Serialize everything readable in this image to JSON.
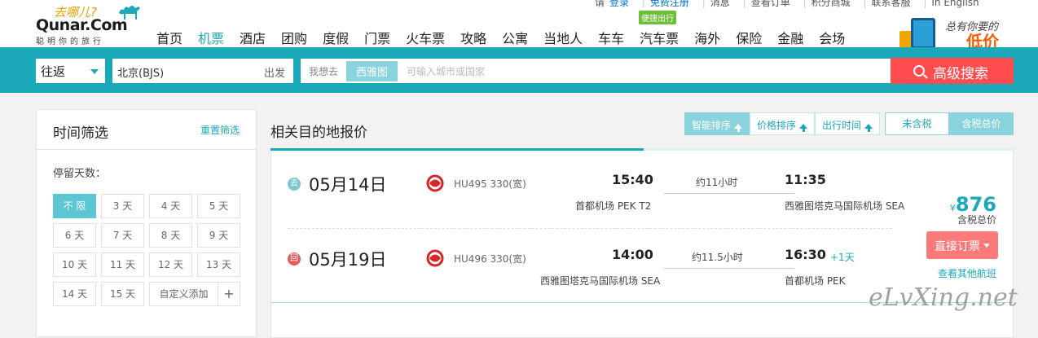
{
  "toplinks": {
    "please": "请",
    "login": "登录",
    "register": "免费注册",
    "messages": "消息",
    "orders": "查看订单",
    "points": "积分商城",
    "contact": "联系客服",
    "english": "In English"
  },
  "logo": {
    "cn": "去哪儿?",
    "en": "Qunar.Com",
    "slogan": "聪明你的旅行"
  },
  "nav": [
    "首页",
    "机票",
    "酒店",
    "团购",
    "度假",
    "门票",
    "火车票",
    "攻略",
    "公寓",
    "当地人",
    "车车",
    "汽车票",
    "海外",
    "保险",
    "金融",
    "会场"
  ],
  "nav_badge": "便捷出行",
  "promo": {
    "line1": "总有你要的",
    "line2": "低价"
  },
  "search": {
    "trip_type": "往返",
    "from_city": "北京(BJS)",
    "from_label": "出发",
    "to_prefix": "我想去",
    "to_tag": "西雅图",
    "to_placeholder": "可输入城市或国家",
    "advanced_label": "高级搜索"
  },
  "filter": {
    "title": "时间筛选",
    "reset": "重置筛选",
    "stay_label": "停留天数：",
    "days": [
      "不 限",
      "3 天",
      "4 天",
      "5 天",
      "6 天",
      "7 天",
      "8 天",
      "9 天",
      "10 天",
      "11 天",
      "12 天",
      "13 天",
      "14 天",
      "15 天"
    ],
    "custom": "自定义添加",
    "plus": "+"
  },
  "results": {
    "title": "相关目的地报价",
    "progress_fraction": 0.502,
    "sorts": [
      "智能排序",
      "价格排序",
      "出行时间"
    ],
    "tax": [
      "未含税",
      "含税总价"
    ],
    "outbound": {
      "icon": "去",
      "date": "05月14日",
      "flight": "HU495 330(宽)",
      "dep_time": "15:40",
      "duration": "约11小时",
      "arr_time": "11:35",
      "dep_airport": "首都机场 PEK T2",
      "arr_airport": "西雅图塔克马国际机场 SEA"
    },
    "inbound": {
      "icon": "回",
      "date": "05月19日",
      "flight": "HU496 330(宽)",
      "dep_time": "14:00",
      "duration": "约11.5小时",
      "arr_time": "16:30",
      "plus_day": "+1天",
      "dep_airport": "西雅图塔克马国际机场 SEA",
      "arr_airport": "首都机场 PEK"
    },
    "price": {
      "currency": "¥",
      "amount": "876",
      "note": "含税总价"
    },
    "book_label": "直接订票",
    "other_flights": "查看其他航班"
  },
  "watermark": "eLvXing.net"
}
